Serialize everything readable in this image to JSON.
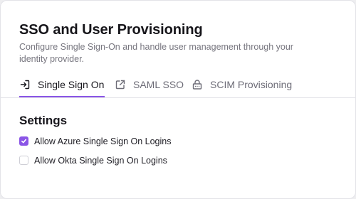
{
  "header": {
    "title": "SSO and User Provisioning",
    "subtitle": "Configure Single Sign-On and handle user management through your identity provider."
  },
  "tabs": [
    {
      "label": "Single Sign On",
      "icon": "sign-in-icon",
      "active": true
    },
    {
      "label": "SAML SSO",
      "icon": "external-link-icon",
      "active": false
    },
    {
      "label": "SCIM Provisioning",
      "icon": "lock-icon",
      "active": false
    }
  ],
  "settings": {
    "title": "Settings",
    "options": [
      {
        "label": "Allow Azure Single Sign On Logins",
        "checked": true
      },
      {
        "label": "Allow Okta Single Sign On Logins",
        "checked": false
      }
    ]
  },
  "colors": {
    "accent": "#8a55e6",
    "text": "#17161c",
    "muted": "#77767f"
  }
}
